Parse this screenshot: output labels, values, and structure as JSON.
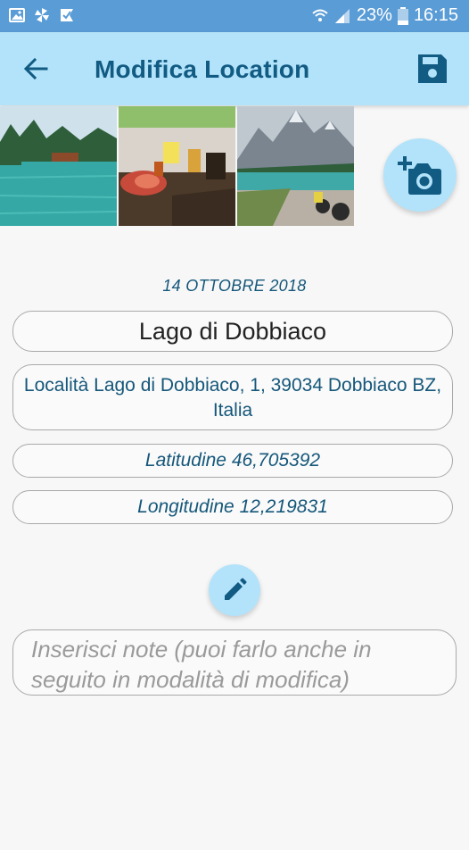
{
  "status_bar": {
    "left_icons": [
      "image-icon",
      "pinwheel-icon",
      "check-flag-icon"
    ],
    "battery_percent": "23%",
    "time": "16:15"
  },
  "app_bar": {
    "title": "Modifica Location",
    "back_icon": "arrow-left-icon",
    "save_icon": "floppy-disk-icon"
  },
  "photos": [
    {
      "name": "lake-photo"
    },
    {
      "name": "food-table-photo"
    },
    {
      "name": "mountain-lake-photo"
    }
  ],
  "add_photo_icon": "add-camera-icon",
  "location": {
    "date": "14 OTTOBRE 2018",
    "name": "Lago di Dobbiaco",
    "address_line1": "Località Lago di Dobbiaco, 1, 39034 Dobbiaco BZ,",
    "address_line2": "Italia",
    "latitude": "Latitudine 46,705392",
    "longitude": "Longitudine 12,219831"
  },
  "edit_icon": "pencil-icon",
  "notes": {
    "placeholder": "Inserisci note (puoi farlo anche in seguito in modalità di modifica)"
  },
  "colors": {
    "status_bar": "#5a9cd6",
    "app_bar": "#b3e3fa",
    "accent_text": "#15577a",
    "title_text": "#125b83"
  }
}
